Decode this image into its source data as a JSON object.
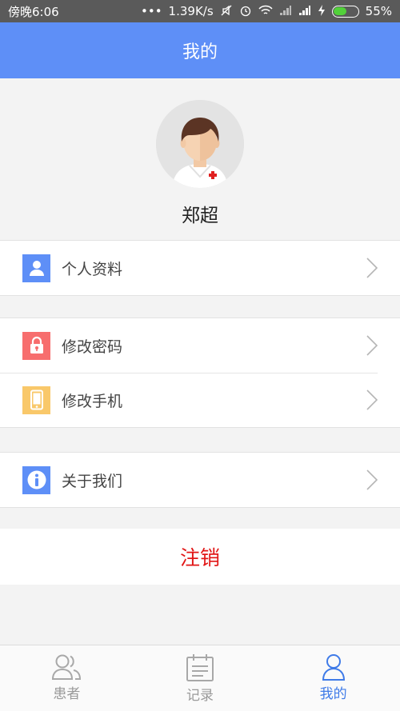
{
  "status_bar": {
    "time": "傍晚6:06",
    "dots": "•••",
    "speed": "1.39K/s",
    "battery_percent": "55%",
    "battery_level": 0.55
  },
  "header": {
    "title": "我的"
  },
  "profile": {
    "name": "郑超"
  },
  "menu": {
    "personal_info": "个人资料",
    "change_password": "修改密码",
    "change_phone": "修改手机",
    "about_us": "关于我们"
  },
  "logout": {
    "label": "注销"
  },
  "tabs": [
    {
      "label": "患者",
      "icon": "patients-icon",
      "active": false
    },
    {
      "label": "记录",
      "icon": "records-icon",
      "active": false
    },
    {
      "label": "我的",
      "icon": "me-icon",
      "active": true
    }
  ],
  "colors": {
    "header": "#5e8ff7",
    "accent": "#3f7be8",
    "logout": "#e11616",
    "icon_blue": "#5e8ff7",
    "icon_red": "#f76e6e",
    "icon_yellow": "#f9c86a"
  }
}
